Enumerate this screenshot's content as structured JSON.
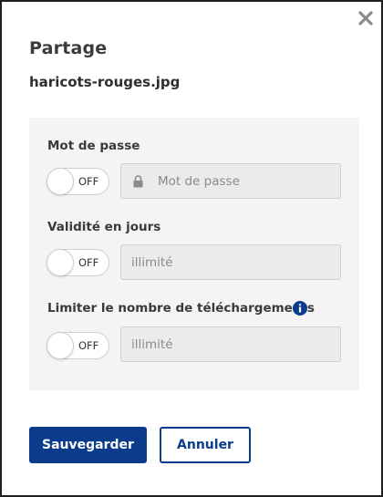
{
  "dialog": {
    "title": "Partage",
    "filename": "haricots-rouges.jpg",
    "close_icon": "close-icon"
  },
  "fields": {
    "password": {
      "label": "Mot de passe",
      "toggle_state": "OFF",
      "placeholder": "Mot de passe",
      "icon": "lock-icon"
    },
    "validity": {
      "label": "Validité en jours",
      "toggle_state": "OFF",
      "placeholder": "illimité"
    },
    "download_limit": {
      "label": "Limiter le nombre de téléchargements",
      "toggle_state": "OFF",
      "placeholder": "illimité",
      "icon": "info-icon"
    }
  },
  "actions": {
    "save_label": "Sauvegarder",
    "cancel_label": "Annuler"
  },
  "colors": {
    "primary": "#0b3c8c",
    "panel_bg": "#f4f4f4",
    "input_bg": "#ebebeb"
  }
}
